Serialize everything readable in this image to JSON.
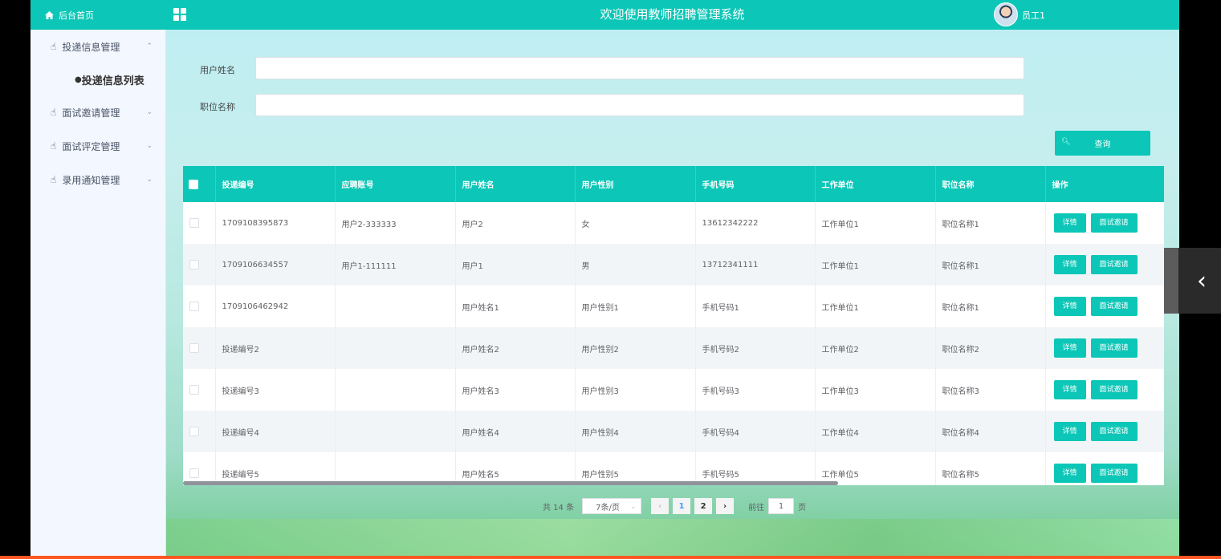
{
  "colors": {
    "accent": "#0cc7b7",
    "page_bg": "#eef3fb"
  },
  "sidebar": {
    "home_label": "后台首页",
    "groups": [
      {
        "label": "投递信息管理",
        "expanded": true,
        "children": [
          "投递信息列表"
        ]
      },
      {
        "label": "面试邀请管理",
        "expanded": false
      },
      {
        "label": "面试评定管理",
        "expanded": false
      },
      {
        "label": "录用通知管理",
        "expanded": false
      }
    ]
  },
  "header": {
    "title": "欢迎使用教师招聘管理系统",
    "user_name": "员工1"
  },
  "search": {
    "fields": [
      {
        "label": "用户姓名",
        "value": "",
        "placeholder": ""
      },
      {
        "label": "职位名称",
        "value": "",
        "placeholder": ""
      }
    ],
    "query_label": "查询"
  },
  "table": {
    "headers": [
      "投递编号",
      "应聘账号",
      "用户姓名",
      "用户性别",
      "手机号码",
      "工作单位",
      "职位名称",
      "操作"
    ],
    "rows": [
      [
        "1709108395873",
        "用户2-333333",
        "用户2",
        "女",
        "13612342222",
        "工作单位1",
        "职位名称1"
      ],
      [
        "1709106634557",
        "用户1-111111",
        "用户1",
        "男",
        "13712341111",
        "工作单位1",
        "职位名称1"
      ],
      [
        "1709106462942",
        "",
        "用户姓名1",
        "用户性别1",
        "手机号码1",
        "工作单位1",
        "职位名称1"
      ],
      [
        "投递编号2",
        "",
        "用户姓名2",
        "用户性别2",
        "手机号码2",
        "工作单位2",
        "职位名称2"
      ],
      [
        "投递编号3",
        "",
        "用户姓名3",
        "用户性别3",
        "手机号码3",
        "工作单位3",
        "职位名称3"
      ],
      [
        "投递编号4",
        "",
        "用户姓名4",
        "用户性别4",
        "手机号码4",
        "工作单位4",
        "职位名称4"
      ],
      [
        "投递编号5",
        "",
        "用户姓名5",
        "用户性别5",
        "手机号码5",
        "工作单位5",
        "职位名称5"
      ]
    ],
    "row_actions": [
      "详情",
      "面试邀请"
    ]
  },
  "pagination": {
    "total_text": "共 14 条",
    "page_size": "7条/页",
    "pages": [
      "1",
      "2"
    ],
    "current_page": "1",
    "goto_label": "前往",
    "goto_value": "1",
    "page_suffix": "页"
  }
}
